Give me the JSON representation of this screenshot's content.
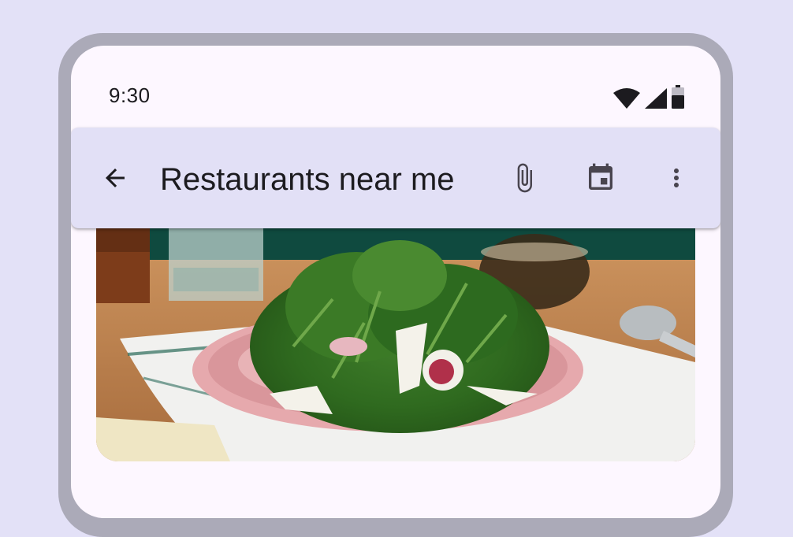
{
  "status_bar": {
    "time": "9:30",
    "icons": [
      "wifi-icon",
      "cellular-signal-icon",
      "battery-icon"
    ]
  },
  "app_bar": {
    "title": "Restaurants near me",
    "navigation_icon": "arrow-back-icon",
    "actions": [
      "attach-file-icon",
      "calendar-icon",
      "more-vert-icon"
    ]
  },
  "content": {
    "hero_image": "salad-plate-photo"
  },
  "colors": {
    "background": "#e3e1f7",
    "device_frame": "#abaab8",
    "surface": "#fdf7ff",
    "app_bar": "#e2e0f6",
    "on_surface": "#1c1b1f",
    "icon": "#49454f"
  }
}
